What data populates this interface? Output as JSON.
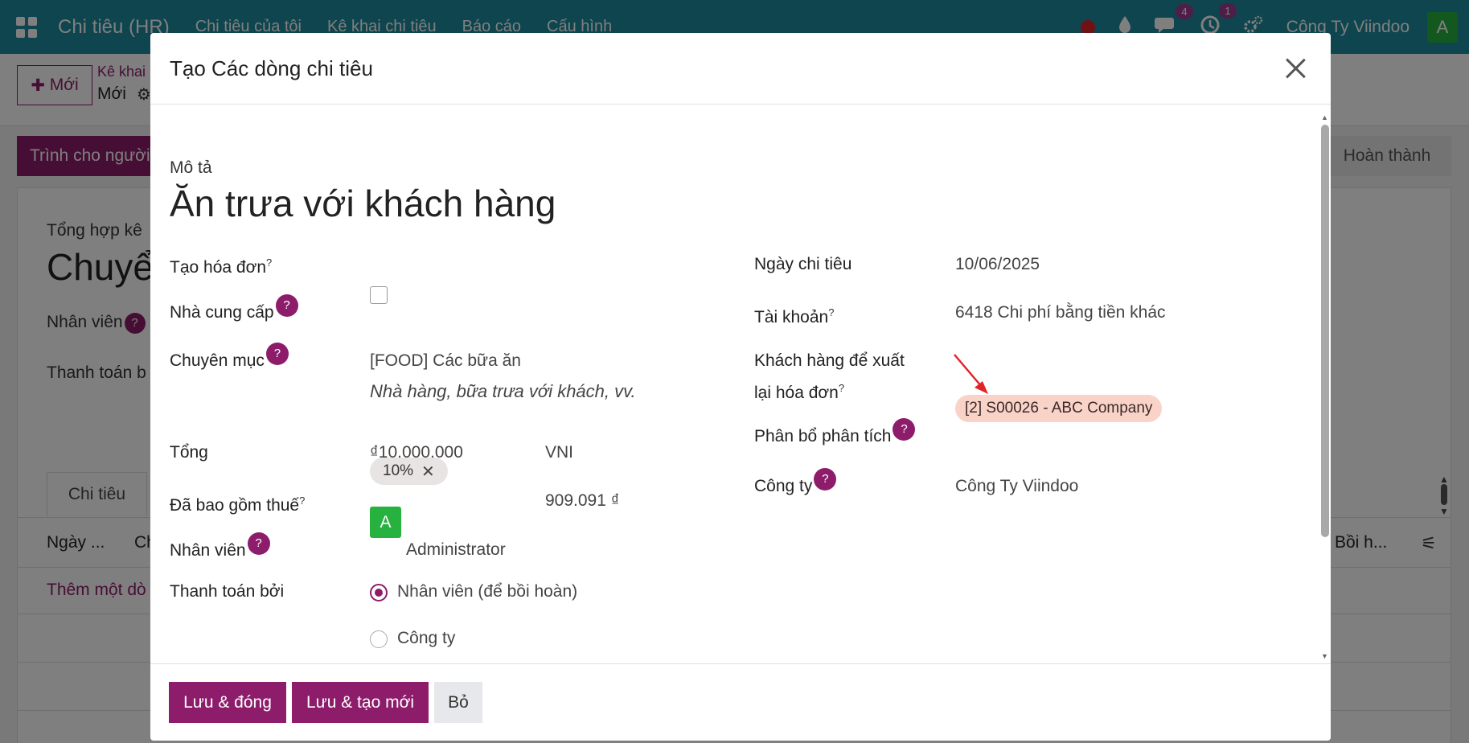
{
  "navbar": {
    "app_name": "Chi tiêu (HR)",
    "menu": [
      "Chi tiêu của tôi",
      "Kê khai chi tiêu",
      "Báo cáo",
      "Cấu hình"
    ],
    "messages_badge": "4",
    "activities_badge": "1",
    "company": "Công Ty Viindoo",
    "avatar_letter": "A"
  },
  "background": {
    "new_button": "Mới",
    "breadcrumb_parent": "Kê khai",
    "breadcrumb_current": "Mới",
    "submit_button": "Trình cho người",
    "done_button": "Hoàn thành",
    "summary_label": "Tổng hợp kê",
    "summary_title": "Chuyể",
    "employee_label": "Nhân viên",
    "paid_by_label": "Thanh toán b",
    "tab_expenses": "Chi tiêu",
    "col_date": "Ngày ...",
    "col_ch": "Ch",
    "col_reimb": "Bồi h...",
    "add_line": "Thêm một dò"
  },
  "modal": {
    "title": "Tạo Các dòng chi tiêu",
    "description_label": "Mô tả",
    "description_value": "Ăn trưa với khách hàng",
    "left": {
      "create_invoice_label": "Tạo hóa đơn",
      "vendor_label": "Nhà cung cấp",
      "category_label": "Chuyên mục",
      "category_value": "[FOOD] Các bữa ăn",
      "category_description": "Nhà hàng, bữa trưa với khách, vv.",
      "total_label": "Tổng",
      "total_value": "₫10.000.000",
      "currency_value": "VNI",
      "tax_label": "Đã bao gồm thuế",
      "tax_tag": "10%",
      "tax_amount": "909.091 ₫",
      "employee_label": "Nhân viên",
      "employee_avatar": "A",
      "employee_value": "Administrator",
      "paid_by_label": "Thanh toán bởi",
      "paid_by_options": [
        "Nhân viên (để bồi hoàn)",
        "Công ty"
      ],
      "paid_by_selected": "Nhân viên (để bồi hoàn)"
    },
    "right": {
      "date_label": "Ngày chi tiêu",
      "date_value": "10/06/2025",
      "account_label": "Tài khoản",
      "account_value": "6418 Chi phí bằng tiền khác",
      "reinvoice_label_line1": "Khách hàng để xuất",
      "reinvoice_label_line2": "lại hóa đơn",
      "analytic_label": "Phân bổ phân tích",
      "analytic_tag": "[2] S00026 - ABC Company",
      "company_label": "Công ty",
      "company_value": "Công Ty Viindoo"
    },
    "help_glyph": "?",
    "tooltip_mark": "?",
    "footer": {
      "save_close": "Lưu & đóng",
      "save_new": "Lưu & tạo mới",
      "discard": "Bỏ"
    }
  },
  "colors": {
    "navbar": "#1d8a9c",
    "primary": "#8d1d6b",
    "analytic_tag_bg": "#f9d3c8",
    "avatar_green": "#27b13f",
    "annotation_arrow": "#e0242a"
  }
}
